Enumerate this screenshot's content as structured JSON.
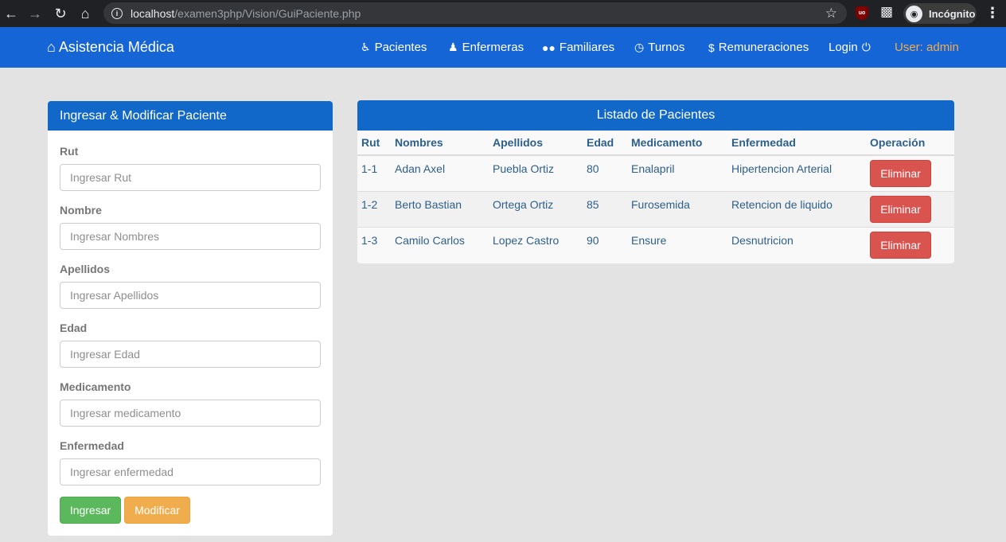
{
  "browser": {
    "url_host": "localhost",
    "url_path": "/examen3php/Vision/GuiPaciente.php",
    "incognito_label": "Incógnito",
    "ext_label": "uo"
  },
  "navbar": {
    "brand": "Asistencia Médica",
    "items": [
      {
        "label": "Pacientes",
        "icon": "wheelchair-icon"
      },
      {
        "label": "Enfermeras",
        "icon": "nurse-icon"
      },
      {
        "label": "Familiares",
        "icon": "users-icon"
      },
      {
        "label": "Turnos",
        "icon": "clock-icon"
      },
      {
        "label": "Remuneraciones",
        "icon": "dollar-icon"
      },
      {
        "label": "Login",
        "icon": "power-icon"
      }
    ],
    "user": "User: admin",
    "colors": {
      "bar": "#1565d6",
      "user": "#f0ad4e"
    }
  },
  "form": {
    "title": "Ingresar & Modificar Paciente",
    "fields": [
      {
        "label": "Rut",
        "placeholder": "Ingresar Rut"
      },
      {
        "label": "Nombre",
        "placeholder": "Ingresar Nombres"
      },
      {
        "label": "Apellidos",
        "placeholder": "Ingresar Apellidos"
      },
      {
        "label": "Edad",
        "placeholder": "Ingresar Edad"
      },
      {
        "label": "Medicamento",
        "placeholder": "Ingresar medicamento"
      },
      {
        "label": "Enfermedad",
        "placeholder": "Ingresar enfermedad"
      }
    ],
    "submit_label": "Ingresar",
    "modify_label": "Modificar"
  },
  "table": {
    "title": "Listado de Pacientes",
    "headers": [
      "Rut",
      "Nombres",
      "Apellidos",
      "Edad",
      "Medicamento",
      "Enfermedad",
      "Operación"
    ],
    "rows": [
      [
        "1-1",
        "Adan Axel",
        "Puebla Ortiz",
        "80",
        "Enalapril",
        "Hipertencion Arterial",
        "Eliminar"
      ],
      [
        "1-2",
        "Berto Bastian",
        "Ortega Ortiz",
        "85",
        "Furosemida",
        "Retencion de liquido",
        "Eliminar"
      ],
      [
        "1-3",
        "Camilo Carlos",
        "Lopez Castro",
        "90",
        "Ensure",
        "Desnutricion",
        "Eliminar"
      ]
    ]
  }
}
